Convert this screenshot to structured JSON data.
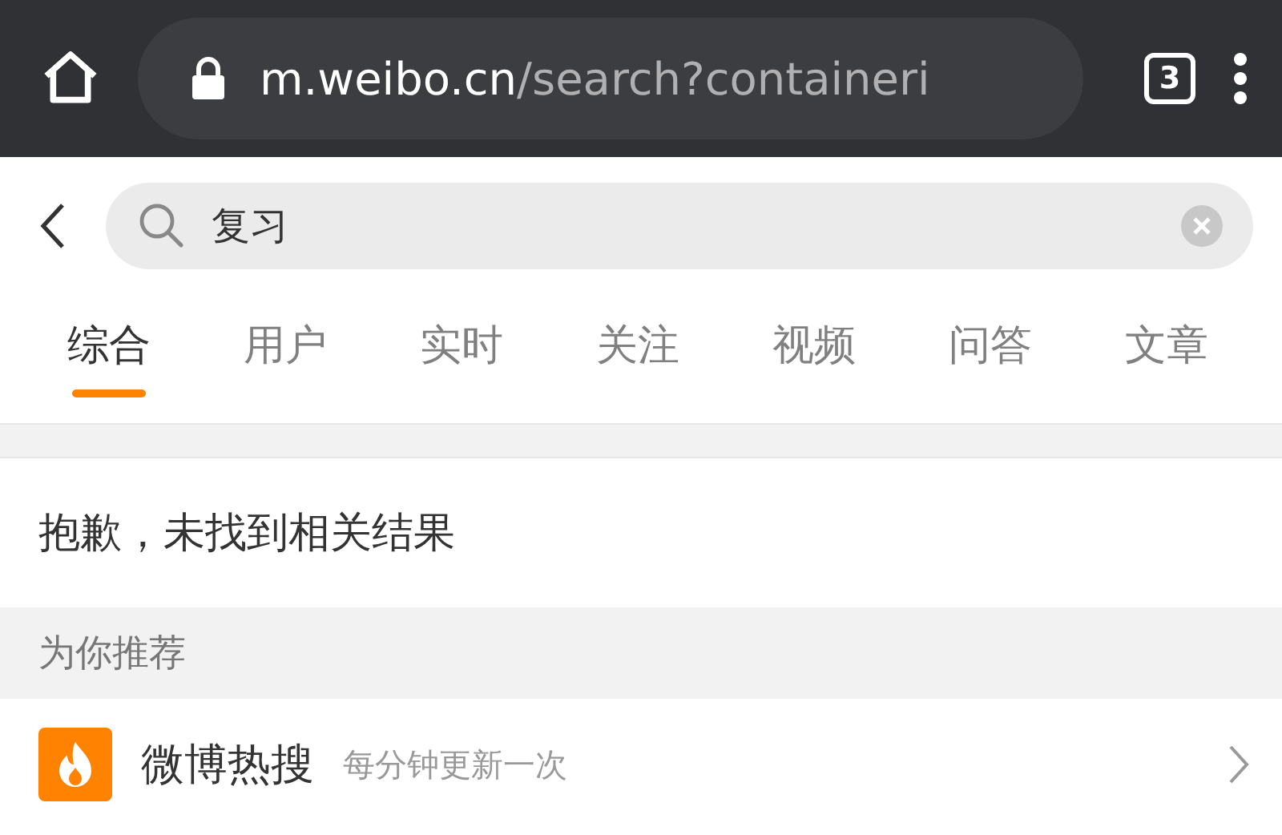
{
  "browser": {
    "url_host": "m.weibo.cn",
    "url_path": "/search?containeri",
    "tab_count": "3"
  },
  "search": {
    "value": "复习"
  },
  "tabs": [
    {
      "label": "综合",
      "selected": true
    },
    {
      "label": "用户",
      "selected": false
    },
    {
      "label": "实时",
      "selected": false
    },
    {
      "label": "关注",
      "selected": false
    },
    {
      "label": "视频",
      "selected": false
    },
    {
      "label": "问答",
      "selected": false
    },
    {
      "label": "文章",
      "selected": false
    }
  ],
  "message": "抱歉，未找到相关结果",
  "section_title": "为你推荐",
  "recommendations": [
    {
      "title": "微博热搜",
      "subtitle": "每分钟更新一次"
    }
  ]
}
